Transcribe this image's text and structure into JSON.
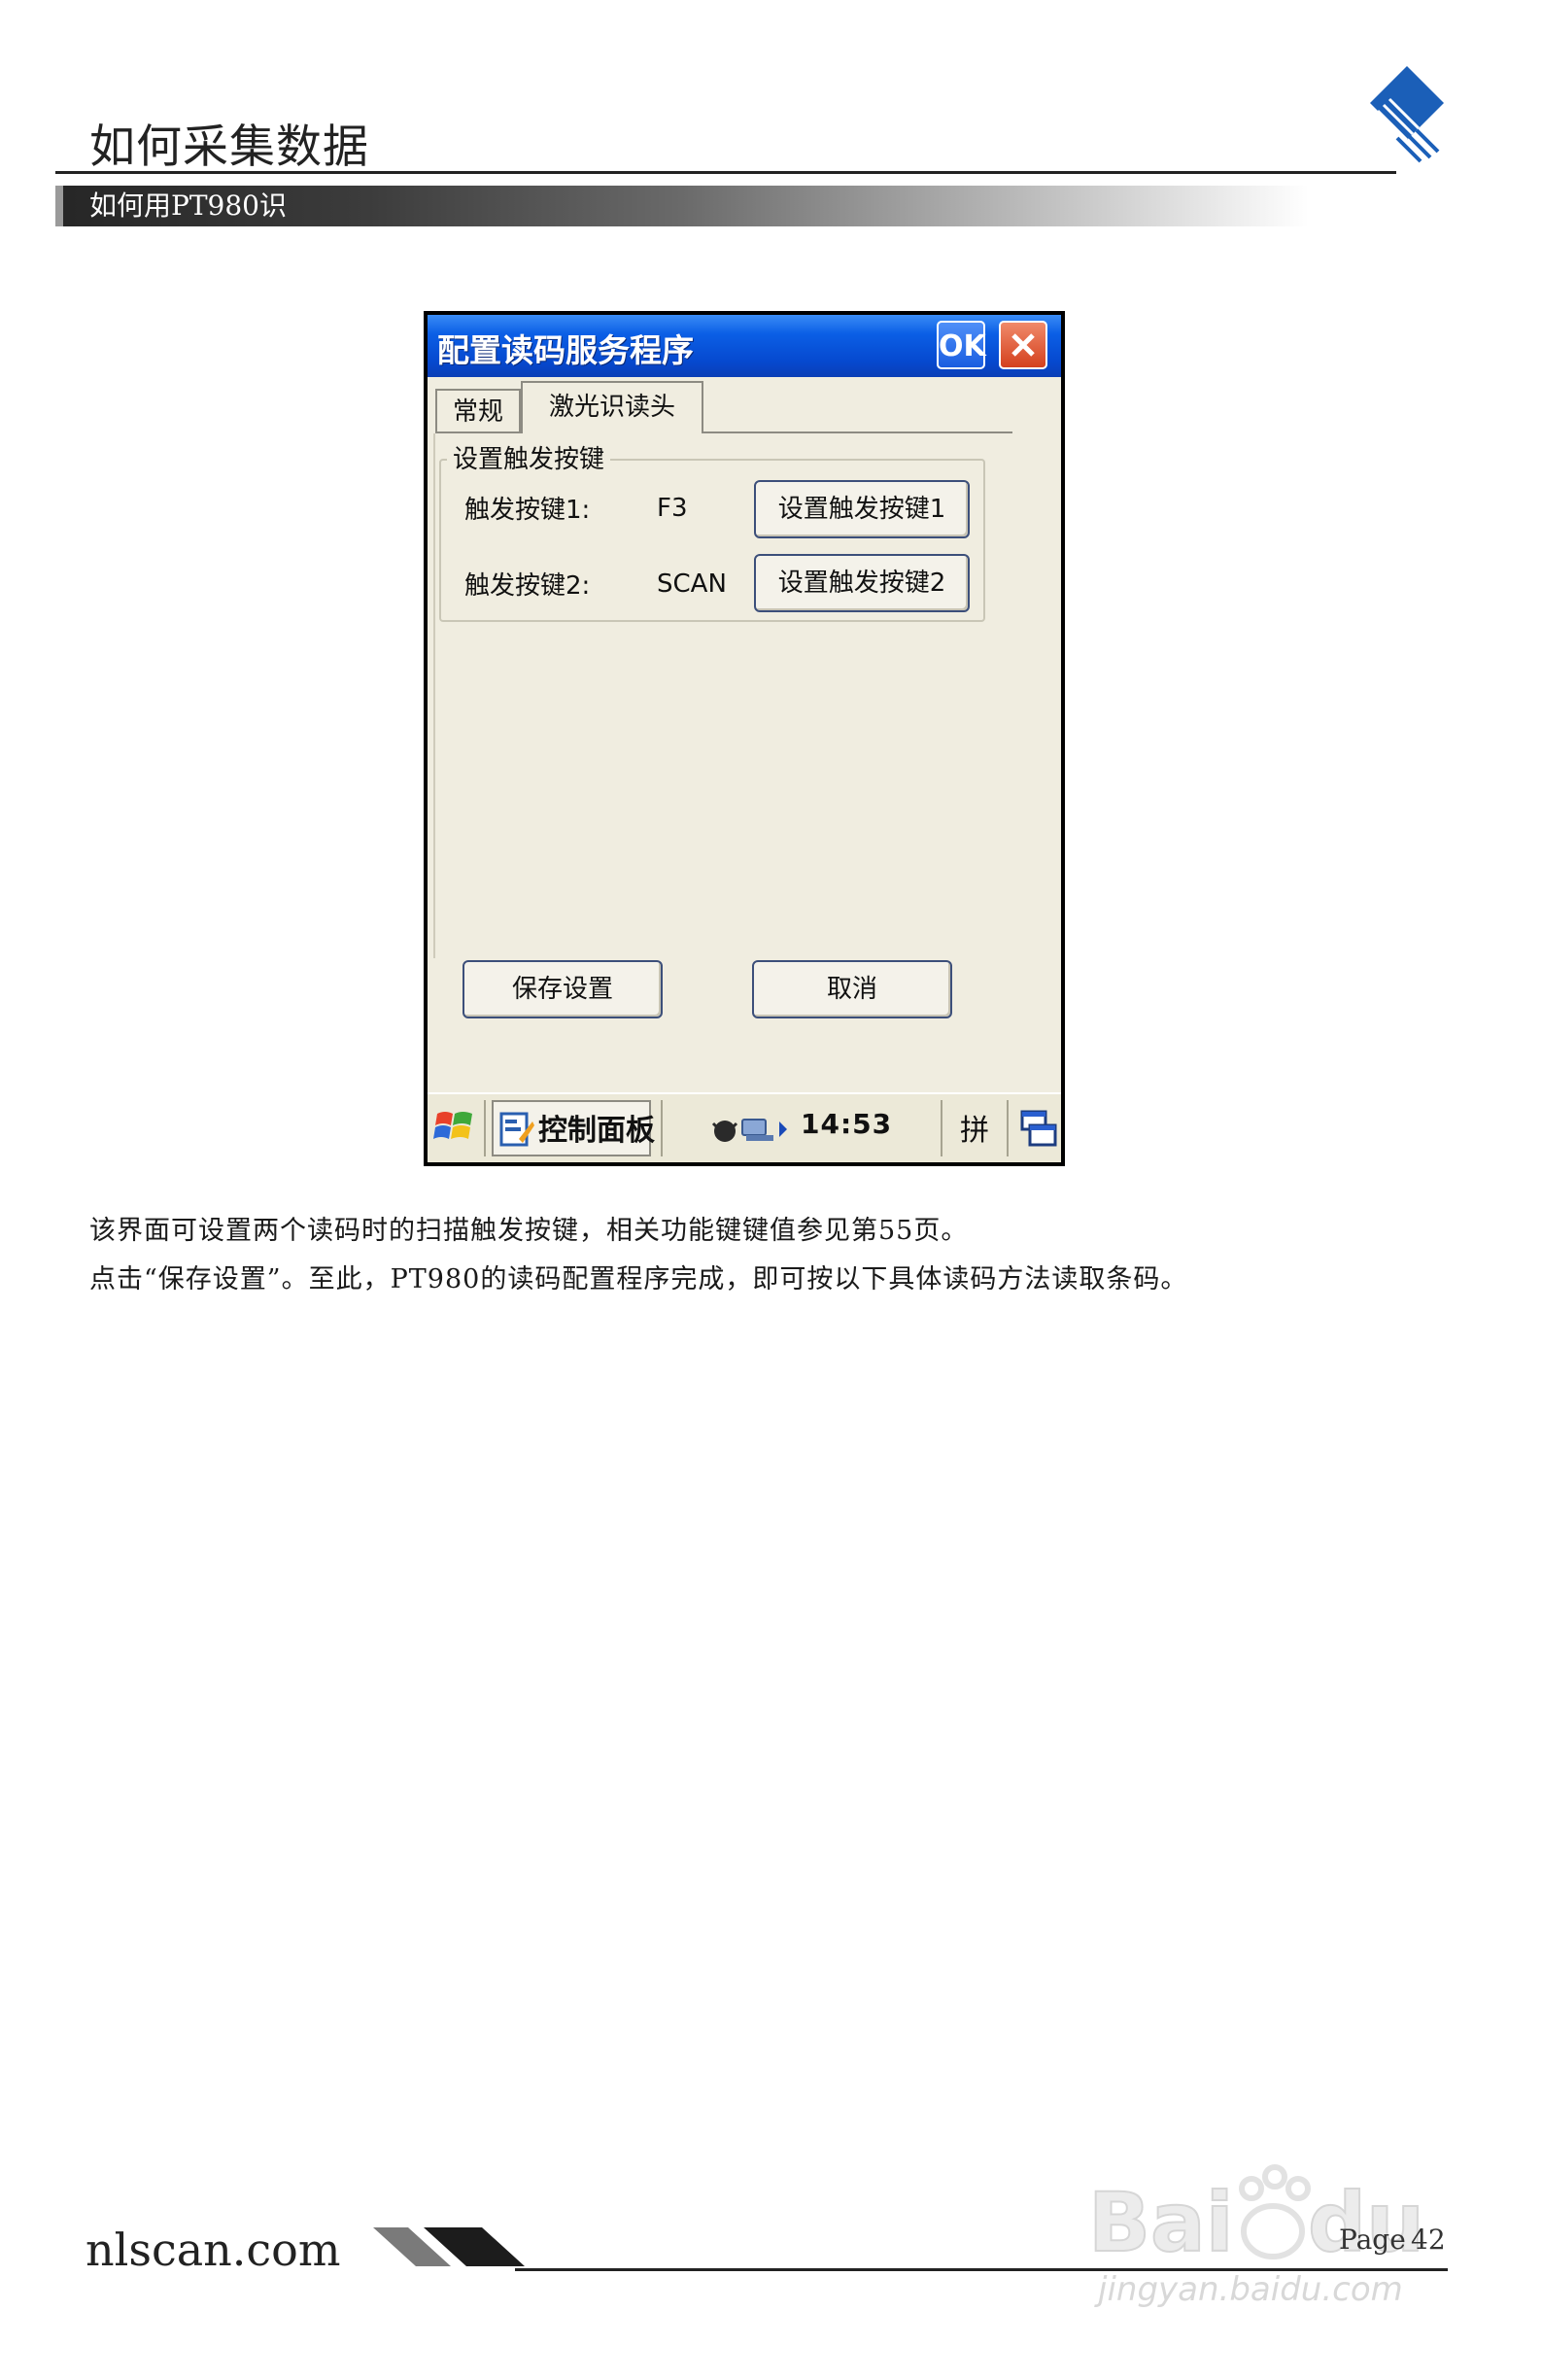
{
  "header": {
    "title": "如何采集数据",
    "section": "如何用PT980识"
  },
  "device_screen": {
    "window_title": "配置读码服务程序",
    "ok_label": "OK",
    "tabs": [
      "常规",
      "激光识读头"
    ],
    "active_tab": "激光识读头",
    "group_title": "设置触发按键",
    "trigger_keys": [
      {
        "label": "触发按键1:",
        "value": "F3",
        "button": "设置触发按键1"
      },
      {
        "label": "触发按键2:",
        "value": "SCAN",
        "button": "设置触发按键2"
      }
    ],
    "save_label": "保存设置",
    "cancel_label": "取消",
    "taskbar": {
      "app_label": "控制面板",
      "clock": "14:53",
      "ime": "拼"
    },
    "colors": {
      "titlebar": "#0b5fe6",
      "window_bg": "#f0ede0",
      "close_button": "#d4401e"
    }
  },
  "body": {
    "paragraphs": [
      "该界面可设置两个读码时的扫描触发按键，相关功能键键值参见第55页。",
      "点击“保存设置”。至此，PT980的读码配置程序完成，即可按以下具体读码方法读取条码。"
    ]
  },
  "footer": {
    "domain": "nlscan.com",
    "page_label": "Page",
    "page_number": "42",
    "watermark": "jingyan.baidu.com"
  }
}
